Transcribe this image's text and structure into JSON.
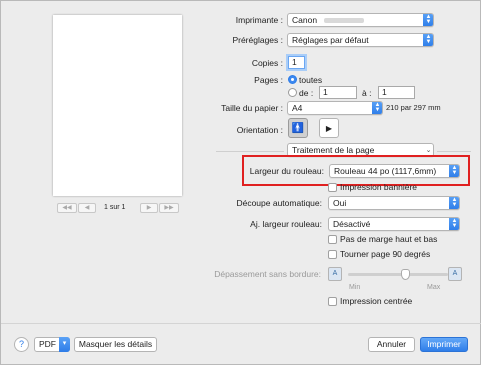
{
  "printer": {
    "label": "Imprimante :",
    "value": "Canon"
  },
  "presets": {
    "label": "Préréglages :",
    "value": "Réglages par défaut"
  },
  "copies": {
    "label": "Copies :",
    "value": "1"
  },
  "pages": {
    "label": "Pages :",
    "all_label": "toutes",
    "from_label": "de :",
    "from_value": "1",
    "to_label": "à :",
    "to_value": "1"
  },
  "paper_size": {
    "label": "Taille du papier :",
    "value": "A4",
    "dimensions": "210 par 297 mm"
  },
  "orientation": {
    "label": "Orientation :"
  },
  "section_popup": {
    "value": "Traitement de la page"
  },
  "roll_width": {
    "label": "Largeur du rouleau:",
    "value": "Rouleau 44 po (1117,6mm)"
  },
  "banner_print": {
    "label": "Impression bannière"
  },
  "auto_cut": {
    "label": "Découpe automatique:",
    "value": "Oui"
  },
  "adjust_roll": {
    "label": "Aj. largeur rouleau:",
    "value": "Désactivé"
  },
  "no_margin": {
    "label": "Pas de marge haut et bas"
  },
  "rotate90": {
    "label": "Tourner page 90 degrés"
  },
  "overflow": {
    "label": "Dépassement sans bordure:",
    "min": "Min",
    "max": "Max"
  },
  "centered": {
    "label": "Impression centrée"
  },
  "preview": {
    "page_indicator": "1 sur 1"
  },
  "footer": {
    "help": "?",
    "pdf": "PDF",
    "hide_details": "Masquer les détails",
    "cancel": "Annuler",
    "print": "Imprimer"
  },
  "colors": {
    "accent": "#2d7ce8",
    "highlight": "#e02020"
  }
}
